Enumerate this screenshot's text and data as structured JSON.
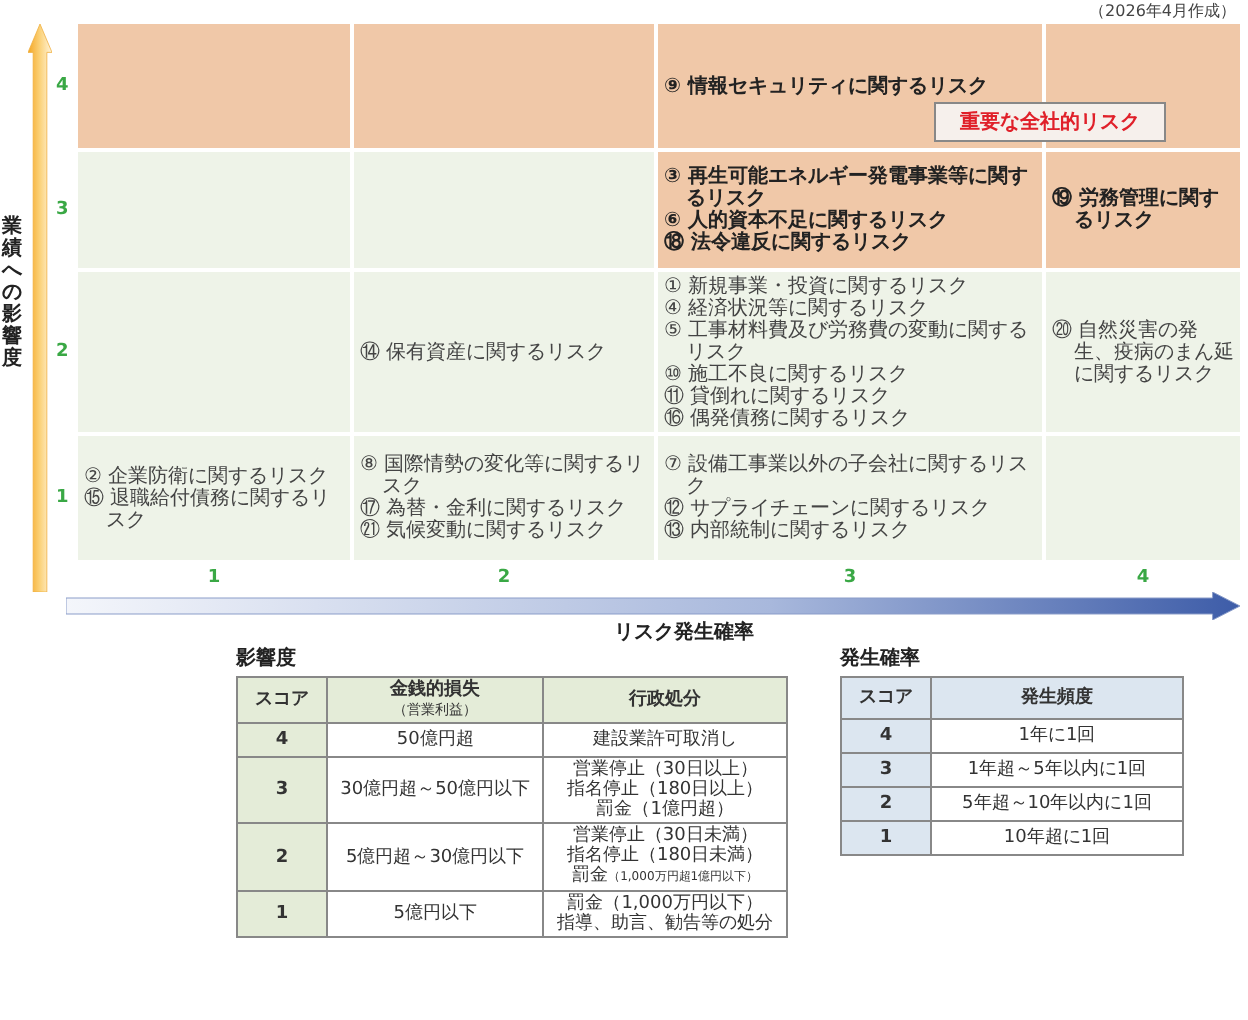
{
  "note": "（2026年4月作成）",
  "y_axis": {
    "label": "業績への影響度",
    "ticks": [
      "4",
      "3",
      "2",
      "1"
    ]
  },
  "matrix": {
    "rows": [
      {
        "cells": [
          {
            "important": true
          },
          {
            "important": true
          },
          {
            "important": true,
            "items": [
              "⑨ 情報セキュリティに関するリスク"
            ]
          },
          {
            "important": true
          }
        ]
      },
      {
        "cells": [
          {
            "important": false
          },
          {
            "important": false
          },
          {
            "important": true,
            "items": [
              "③ 再生可能エネルギー発電事業等に関するリスク",
              "⑥ 人的資本不足に関するリスク",
              "⑱ 法令違反に関するリスク"
            ]
          },
          {
            "important": true,
            "items": [
              "⑲ 労務管理に関するリスク"
            ]
          }
        ]
      },
      {
        "cells": [
          {
            "important": false
          },
          {
            "important": false,
            "items": [
              "⑭ 保有資産に関するリスク"
            ]
          },
          {
            "important": false,
            "items": [
              "① 新規事業・投資に関するリスク",
              "④ 経済状況等に関するリスク",
              "⑤ 工事材料費及び労務費の変動に関するリスク",
              "⑩ 施工不良に関するリスク",
              "⑪ 貸倒れに関するリスク",
              "⑯ 偶発債務に関するリスク"
            ]
          },
          {
            "important": false,
            "items": [
              "⑳ 自然災害の発生、疫病のまん延に関するリスク"
            ]
          }
        ]
      },
      {
        "cells": [
          {
            "important": false,
            "items": [
              "② 企業防衛に関するリスク",
              "⑮ 退職給付債務に関するリスク"
            ]
          },
          {
            "important": false,
            "items": [
              "⑧ 国際情勢の変化等に関するリスク",
              "⑰ 為替・金利に関するリスク",
              "㉑ 気候変動に関するリスク"
            ]
          },
          {
            "important": false,
            "items": [
              "⑦ 設備工事業以外の子会社に関するリスク",
              "⑫ サプライチェーンに関するリスク",
              "⑬ 内部統制に関するリスク"
            ]
          },
          {
            "important": false
          }
        ]
      }
    ]
  },
  "callout": "重要な全社的リスク",
  "x_axis": {
    "ticks": [
      "1",
      "2",
      "3",
      "4"
    ],
    "label": "リスク発生確率"
  },
  "tables": [
    {
      "title": "影響度",
      "columns": [
        {
          "text": "スコア"
        },
        {
          "text": "金銭的損失",
          "sub": "（営業利益）"
        },
        {
          "text": "行政処分"
        }
      ],
      "rows": [
        [
          [
            "4"
          ],
          [
            "50億円超"
          ],
          [
            "建設業許可取消し"
          ]
        ],
        [
          [
            "3"
          ],
          [
            "30億円超～50億円以下"
          ],
          [
            "営業停止（30日以上）",
            "指名停止（180日以上）",
            "罰金（1億円超）"
          ]
        ],
        [
          [
            "2"
          ],
          [
            "5億円超～30億円以下"
          ],
          [
            "営業停止（30日未満）",
            "指名停止（180日未満）",
            {
              "text": "罰金",
              "note": "（1,000万円超1億円以下）"
            }
          ]
        ],
        [
          [
            "1"
          ],
          [
            "5億円以下"
          ],
          [
            "罰金（1,000万円以下）",
            "指導、助言、勧告等の処分"
          ]
        ]
      ]
    },
    {
      "title": "発生確率",
      "columns": [
        {
          "text": "スコア"
        },
        {
          "text": "発生頻度"
        }
      ],
      "rows": [
        [
          [
            "4"
          ],
          [
            "1年に1回"
          ]
        ],
        [
          [
            "3"
          ],
          [
            "1年超～5年以内に1回"
          ]
        ],
        [
          [
            "2"
          ],
          [
            "5年超～10年以内に1回"
          ]
        ],
        [
          [
            "1"
          ],
          [
            "10年超に1回"
          ]
        ]
      ]
    }
  ]
}
